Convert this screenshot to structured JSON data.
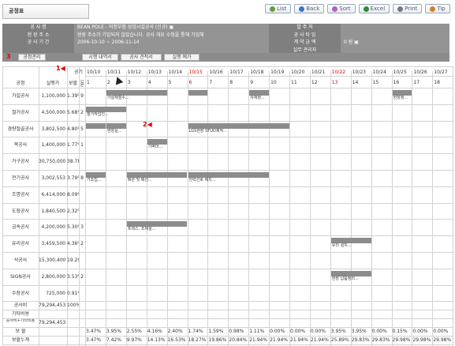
{
  "window_title": "공정표",
  "toolbar": [
    {
      "label": "List",
      "icon": "list-icon",
      "color": "#6a9a3a"
    },
    {
      "label": "Back",
      "icon": "back-icon",
      "color": "#3a72c8"
    },
    {
      "label": "Sort",
      "icon": "sort-icon",
      "color": "#b060c0"
    },
    {
      "label": "Excel",
      "icon": "excel-icon",
      "color": "#2a8a3a"
    },
    {
      "label": "Print",
      "icon": "print-icon",
      "color": "#777777"
    },
    {
      "label": "Tip",
      "icon": "tip-icon",
      "color": "#d08020"
    }
  ],
  "info_rows": [
    {
      "label1": "공 사 명",
      "value1": "BEAN POLE - 의정부점 상업시설공사 (신규) ▣",
      "label2": "발 주 처",
      "value2": ""
    },
    {
      "label1": "현 장 주 소",
      "value1": "현장 주소가 기입되지 않았습니다. 공사 개요 수정을 통해 기입해",
      "label2": "공 사 타 입",
      "value2": ""
    },
    {
      "label1": "공 사 기 간",
      "value1": "2006-10-10 ~ 2006-11-14",
      "label2": "계 약 금 액",
      "value2": "0 원 ▣"
    },
    {
      "label1": "",
      "value1": "",
      "label2": "실무 관리자",
      "value2": ""
    }
  ],
  "tabs": [
    "공정관리",
    "시행 내역서",
    "공사 견적서",
    "실행 예가"
  ],
  "annotations": {
    "badge3": "3",
    "marker1": "1",
    "marker2": "2"
  },
  "header": {
    "col_name": "공정",
    "col_cost": "실행가",
    "col_ratio": "보할",
    "col_workers": "인원",
    "col_days": "공기"
  },
  "dates": [
    {
      "date": "10/10",
      "day": "1",
      "red": false
    },
    {
      "date": "10/11",
      "day": "2",
      "red": false
    },
    {
      "date": "10/12",
      "day": "3",
      "red": false
    },
    {
      "date": "10/13",
      "day": "4",
      "red": false
    },
    {
      "date": "10/14",
      "day": "5",
      "red": false
    },
    {
      "date": "10/15",
      "day": "6",
      "red": true
    },
    {
      "date": "10/16",
      "day": "7",
      "red": false
    },
    {
      "date": "10/17",
      "day": "8",
      "red": false
    },
    {
      "date": "10/18",
      "day": "9",
      "red": false
    },
    {
      "date": "10/19",
      "day": "10",
      "red": false
    },
    {
      "date": "10/20",
      "day": "11",
      "red": false
    },
    {
      "date": "10/21",
      "day": "12",
      "red": false
    },
    {
      "date": "10/22",
      "day": "13",
      "red": true
    },
    {
      "date": "10/23",
      "day": "14",
      "red": false
    },
    {
      "date": "10/24",
      "day": "15",
      "red": false
    },
    {
      "date": "10/25",
      "day": "16",
      "red": false
    },
    {
      "date": "10/26",
      "day": "17",
      "red": false
    },
    {
      "date": "10/27",
      "day": "18",
      "red": false
    }
  ],
  "tasks": [
    {
      "name": "가설공사",
      "cost": "1,100,000",
      "ratio": "1.39%",
      "workers": "9",
      "bars": [
        {
          "start": 2,
          "end": 5,
          "label": "가설재철수..."
        },
        {
          "start": 6,
          "end": 7,
          "label": ""
        },
        {
          "start": 9,
          "end": 10,
          "label": "자재정..."
        },
        {
          "start": 16,
          "end": 17,
          "label": "현장청..."
        }
      ]
    },
    {
      "name": "철거공사",
      "cost": "4,500,000",
      "ratio": "5.68%",
      "workers": "2",
      "bars": [
        {
          "start": 1,
          "end": 3,
          "label": "철거작업진..."
        }
      ]
    },
    {
      "name": "경량철골공사",
      "cost": "3,802,500",
      "ratio": "4.80%",
      "workers": "5",
      "bars": [
        {
          "start": 1,
          "end": 2,
          "label": ""
        },
        {
          "start": 2,
          "end": 3,
          "label": "현장실..."
        },
        {
          "start": 6,
          "end": 11,
          "label": "LGS현장 STUD제작..."
        }
      ]
    },
    {
      "name": "목공사",
      "cost": "1,400,000",
      "ratio": "1.77%",
      "workers": "1",
      "bars": [
        {
          "start": 4,
          "end": 5,
          "label": "가벽마..."
        }
      ]
    },
    {
      "name": "가구공사",
      "cost": "30,750,000",
      "ratio": "38.78%",
      "workers": "",
      "bars": []
    },
    {
      "name": "전기공사",
      "cost": "3,002,553",
      "ratio": "3.79%",
      "workers": "8",
      "bars": [
        {
          "start": 1,
          "end": 2,
          "label": "가조립..."
        },
        {
          "start": 3,
          "end": 6,
          "label": "배관 및 배선..."
        },
        {
          "start": 6,
          "end": 10,
          "label": "전력선로 배치..."
        }
      ]
    },
    {
      "name": "조명공사",
      "cost": "6,414,000",
      "ratio": "8.09%",
      "workers": "",
      "bars": []
    },
    {
      "name": "도장공사",
      "cost": "1,840,500",
      "ratio": "2.32%",
      "workers": "",
      "bars": []
    },
    {
      "name": "금속공사",
      "cost": "4,200,000",
      "ratio": "5.30%",
      "workers": "3",
      "bars": [
        {
          "start": 3,
          "end": 6,
          "label": "프레스, 조제설..."
        }
      ]
    },
    {
      "name": "유리공사",
      "cost": "3,459,500",
      "ratio": "4.36%",
      "workers": "2",
      "bars": [
        {
          "start": 13,
          "end": 15,
          "label": "유리 설치..."
        }
      ]
    },
    {
      "name": "석공사",
      "cost": "15,300,400",
      "ratio": "19.29%",
      "workers": "",
      "bars": []
    },
    {
      "name": "SIGN공사",
      "cost": "2,800,000",
      "ratio": "3.53%",
      "workers": "2",
      "bars": [
        {
          "start": 13,
          "end": 15,
          "label": "현장 납품정리..."
        }
      ]
    },
    {
      "name": "수장공사",
      "cost": "725,000",
      "ratio": "0.91%",
      "workers": "",
      "bars": []
    }
  ],
  "summary": [
    {
      "name": "공사비",
      "cost": "79,294,453",
      "ratio": "100%"
    },
    {
      "name": "기타비용",
      "cost": "",
      "ratio": ""
    },
    {
      "name": "공사비+기타비용",
      "cost": "79,294,453",
      "ratio": ""
    }
  ],
  "footer": {
    "daily_label": "보 할",
    "daily": [
      "3.47%",
      "3.95%",
      "2.55%",
      "4.16%",
      "2.40%",
      "1.74%",
      "1.59%",
      "0.98%",
      "1.11%",
      "0.00%",
      "0.00%",
      "0.00%",
      "3.95%",
      "3.95%",
      "0.00%",
      "0.15%",
      "0.00%",
      "0.00%"
    ],
    "cumulative_label": "보할누계",
    "cumulative": [
      "3.47%",
      "7.42%",
      "9.97%",
      "14.13%",
      "16.53%",
      "18.27%",
      "19.86%",
      "20.84%",
      "21.94%",
      "21.94%",
      "21.94%",
      "21.94%",
      "25.89%",
      "29.83%",
      "29.83%",
      "29.98%",
      "29.98%",
      "29.98%"
    ]
  }
}
